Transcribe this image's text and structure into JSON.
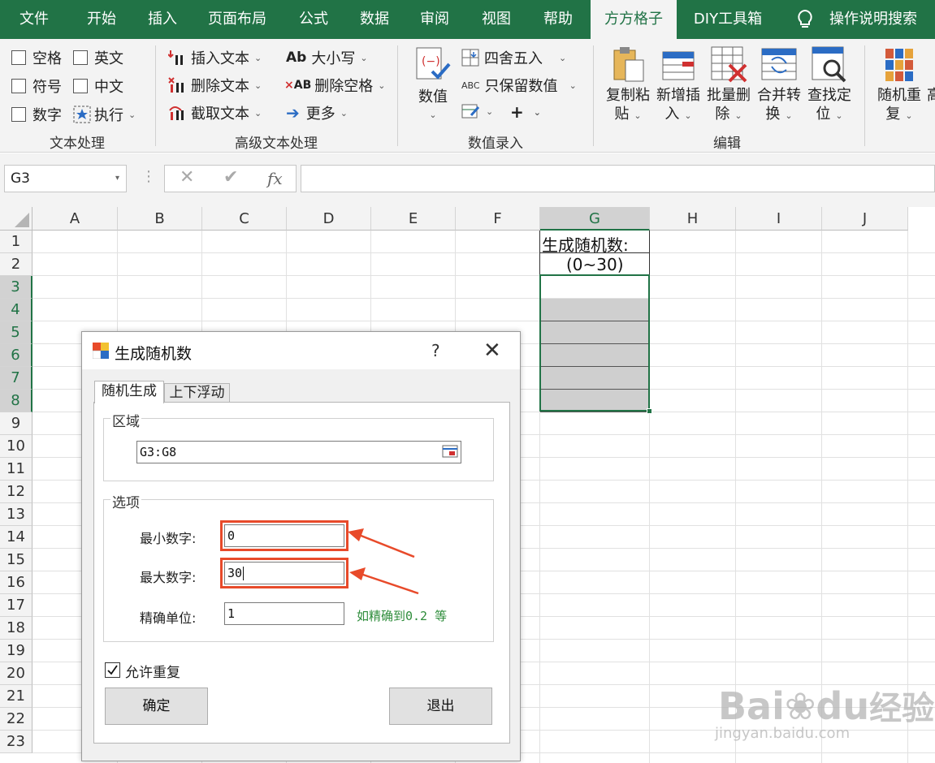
{
  "tabs": [
    "文件",
    "开始",
    "插入",
    "页面布局",
    "公式",
    "数据",
    "审阅",
    "视图",
    "帮助",
    "方方格子",
    "DIY工具箱"
  ],
  "active_tab": "方方格子",
  "search_label": "操作说明搜索",
  "ribbon": {
    "text_processing": {
      "items": [
        "空格",
        "英文",
        "符号",
        "中文",
        "数字",
        "执行"
      ],
      "label": "文本处理"
    },
    "advanced_text": {
      "items": [
        "插入文本",
        "删除文本",
        "截取文本",
        "大小写",
        "删除空格",
        "更多"
      ],
      "label": "高级文本处理"
    },
    "numeric_input": {
      "big_button": "数值",
      "items": [
        "四舍五入",
        "只保留数值"
      ],
      "label": "数值录入"
    },
    "edit": {
      "buttons": [
        {
          "line1": "复制粘",
          "line2": "贴"
        },
        {
          "line1": "新增插",
          "line2": "入"
        },
        {
          "line1": "批量删",
          "line2": "除"
        },
        {
          "line1": "合并转",
          "line2": "换"
        },
        {
          "line1": "查找定",
          "line2": "位"
        }
      ],
      "label": "编辑"
    },
    "random": {
      "line1": "随机重",
      "line2": "复",
      "clipped": "高"
    }
  },
  "formula_bar": {
    "name_box": "G3",
    "fx": "fx",
    "formula": ""
  },
  "columns": [
    "A",
    "B",
    "C",
    "D",
    "E",
    "F",
    "G",
    "H",
    "I",
    "J"
  ],
  "rows": [
    "1",
    "2",
    "3",
    "4",
    "5",
    "6",
    "7",
    "8",
    "9",
    "10",
    "11",
    "12",
    "13",
    "14",
    "15",
    "16",
    "17",
    "18",
    "19",
    "20",
    "21",
    "22",
    "23"
  ],
  "cells": {
    "G1": "生成随机数:",
    "G2": "(0~30)"
  },
  "dialog": {
    "title": "生成随机数",
    "help": "?",
    "tabs": [
      "随机生成",
      "上下浮动"
    ],
    "region_legend": "区域",
    "region_value": "G3:G8",
    "options_legend": "选项",
    "min_label": "最小数字:",
    "min_value": "0",
    "max_label": "最大数字:",
    "max_value": "30",
    "precision_label": "精确单位:",
    "precision_value": "1",
    "precision_hint": "如精确到0.2 等",
    "allow_repeat_label": "允许重复",
    "allow_repeat": true,
    "ok_label": "确定",
    "exit_label": "退出"
  },
  "watermark": {
    "line1": "Bai",
    "line2": "du",
    "line3": "经验",
    "url": "jingyan.baidu.com"
  },
  "colors": {
    "excel_green": "#217346",
    "highlight_red": "#e84a2a",
    "hint_green": "#2d8c3a",
    "selected_fill": "#cfcfcf"
  }
}
